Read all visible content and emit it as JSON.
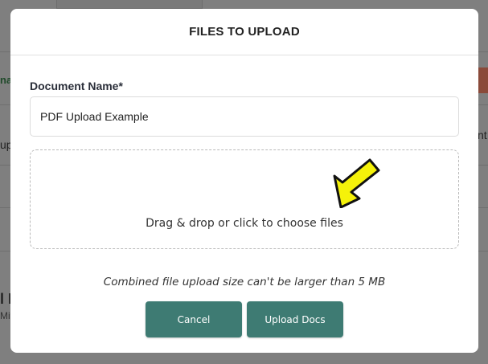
{
  "modal": {
    "title": "FILES TO UPLOAD",
    "document_name_label": "Document Name*",
    "document_name_value": "PDF Upload Example",
    "dropzone_text": "Drag & drop or click to choose files",
    "size_note": "Combined file upload size can't be larger than 5 MB",
    "cancel_label": "Cancel",
    "upload_label": "Upload Docs"
  },
  "background": {
    "fragments": [
      "na",
      "up",
      "nt",
      "l E",
      "Mit"
    ]
  },
  "colors": {
    "button_bg": "#3e7b73",
    "arrow_fill": "#f5f20a",
    "overlay": "#7f7f7f"
  },
  "icons": {
    "pointer": "arrow-icon"
  }
}
